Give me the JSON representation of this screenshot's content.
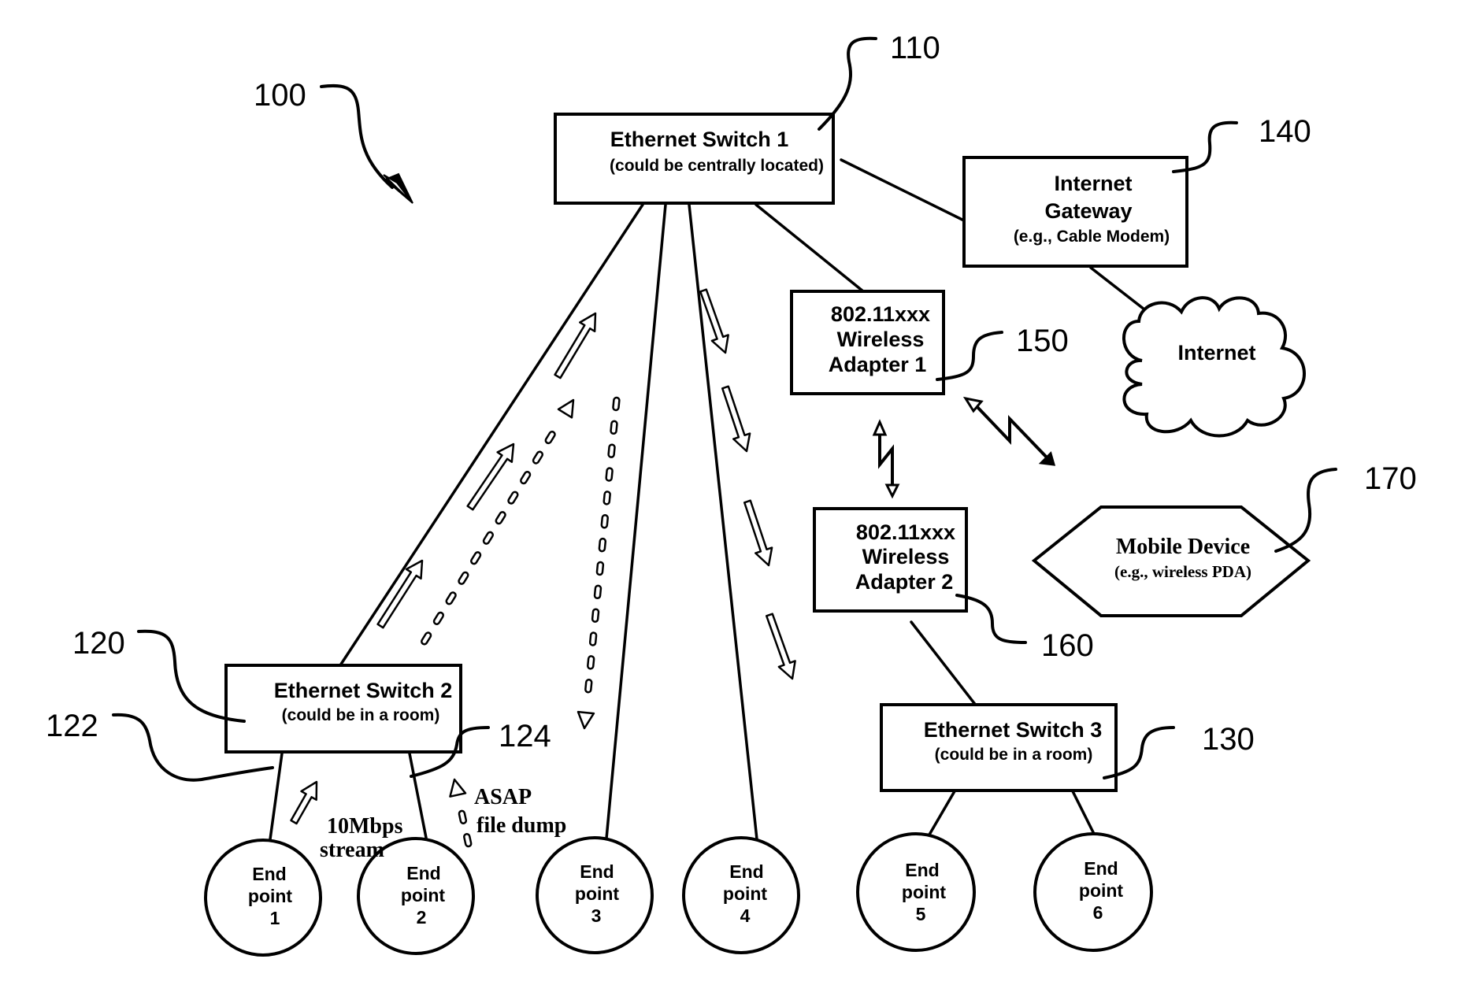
{
  "figure": {
    "reference": "100",
    "nodes": {
      "switch1": {
        "ref": "110",
        "title": "Ethernet Switch 1",
        "subtitle": "(could be centrally located)"
      },
      "gateway": {
        "ref": "140",
        "line1": "Internet",
        "line2": "Gateway",
        "subtitle": "(e.g., Cable Modem)"
      },
      "internet": {
        "label": "Internet"
      },
      "adapter1": {
        "ref": "150",
        "line1": "802.11xxx",
        "line2": "Wireless",
        "line3": "Adapter 1"
      },
      "adapter2": {
        "ref": "160",
        "line1": "802.11xxx",
        "line2": "Wireless",
        "line3": "Adapter 2"
      },
      "mobile": {
        "ref": "170",
        "title": "Mobile Device",
        "subtitle": "(e.g., wireless PDA)"
      },
      "switch2": {
        "ref": "120",
        "title": "Ethernet Switch 2",
        "subtitle": "(could be in a room)",
        "port_left_ref": "122",
        "port_right_ref": "124"
      },
      "switch3": {
        "ref": "130",
        "title": "Ethernet Switch 3",
        "subtitle": "(could be in a room)"
      }
    },
    "endpoints": [
      {
        "line1": "End",
        "line2": "point",
        "num": "1"
      },
      {
        "line1": "End",
        "line2": "point",
        "num": "2"
      },
      {
        "line1": "End",
        "line2": "point",
        "num": "3"
      },
      {
        "line1": "End",
        "line2": "point",
        "num": "4"
      },
      {
        "line1": "End",
        "line2": "point",
        "num": "5"
      },
      {
        "line1": "End",
        "line2": "point",
        "num": "6"
      }
    ],
    "annotations": {
      "stream_line1": "10Mbps",
      "stream_line2": "stream",
      "dump_line1": "ASAP",
      "dump_line2": "file dump"
    }
  }
}
